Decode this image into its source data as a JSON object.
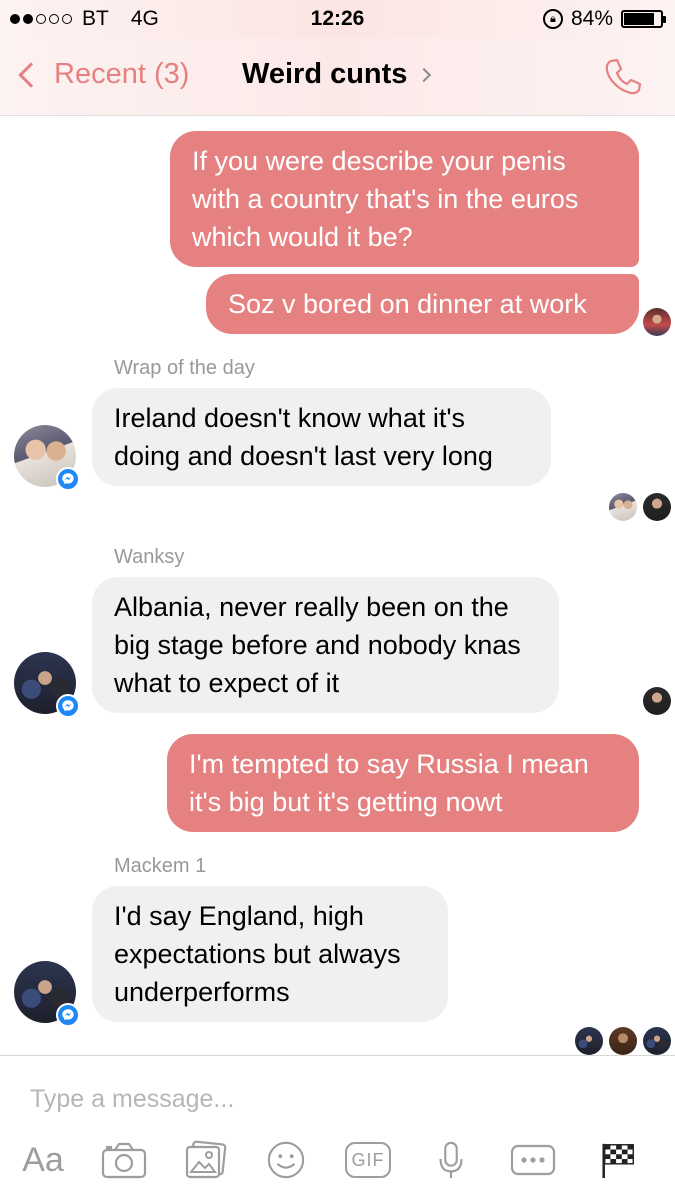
{
  "status_bar": {
    "carrier": "BT",
    "network": "4G",
    "time": "12:26",
    "battery_percent": "84%",
    "battery_level": 0.84,
    "signal_bars_filled": 2,
    "signal_bars_total": 5
  },
  "nav": {
    "back_label": "Recent (3)",
    "title": "Weird cunts",
    "accent_color": "#e58281"
  },
  "messages": [
    {
      "direction": "outgoing",
      "text": "If you were describe your penis with a country that's in the euros which would it be?"
    },
    {
      "direction": "outgoing",
      "text": "Soz v bored on dinner at work"
    },
    {
      "direction": "incoming",
      "sender": "Wrap of the day",
      "text": "Ireland doesn't know what it's doing and doesn't last very long"
    },
    {
      "direction": "incoming",
      "sender": "Wanksy",
      "text": "Albania, never really been on the big stage before and nobody knas what to expect of it"
    },
    {
      "direction": "outgoing",
      "text": "I'm tempted to say Russia I mean it's big but it's getting nowt"
    },
    {
      "direction": "incoming",
      "sender": "Mackem 1",
      "text": "I'd say England, high expectations but always underperforms"
    }
  ],
  "composer": {
    "placeholder": "Type a message...",
    "aa_label": "Aa",
    "gif_label": "GIF",
    "icons": [
      "camera-icon",
      "gallery-icon",
      "emoji-icon",
      "gif-icon",
      "microphone-icon",
      "more-icon",
      "checkered-flag-icon"
    ]
  },
  "colors": {
    "outgoing_bubble": "#e58281",
    "incoming_bubble": "#f0f0f0",
    "messenger_badge": "#1e88f6"
  }
}
